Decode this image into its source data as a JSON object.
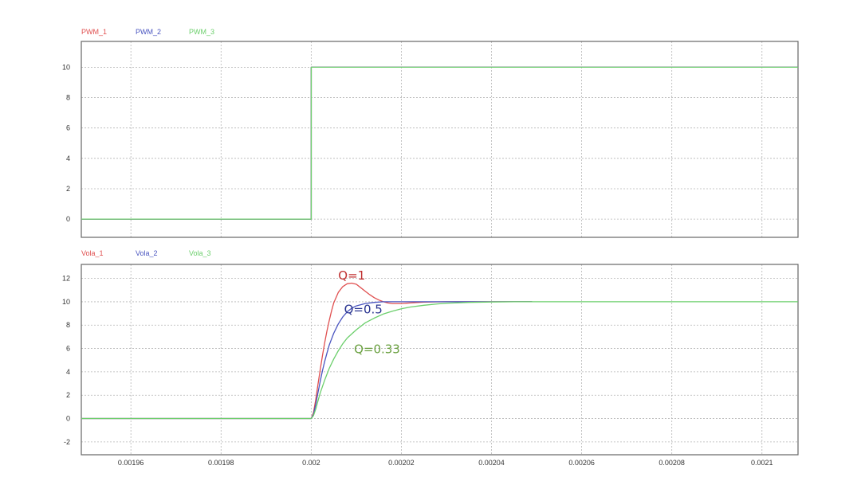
{
  "chart_data": [
    {
      "type": "line",
      "legend_placement": "top-left",
      "grid": true,
      "xlim": [
        0.001949,
        0.002108
      ],
      "ylim": [
        -1.2,
        11.7
      ],
      "x_ticks": [
        0.00196,
        0.00198,
        0.002,
        0.00202,
        0.00204,
        0.00206,
        0.00208,
        0.0021
      ],
      "x_tick_labels": [
        "0.00196",
        "0.00198",
        "0.002",
        "0.00202",
        "0.00204",
        "0.00206",
        "0.00208",
        "0.0021"
      ],
      "y_ticks": [
        0,
        2,
        4,
        6,
        8,
        10
      ],
      "y_tick_labels": [
        "0",
        "2",
        "4",
        "6",
        "8",
        "10"
      ],
      "series": [
        {
          "name": "PWM_1",
          "color": "#e05050",
          "x": [
            0.001949,
            0.002,
            0.002,
            0.002108
          ],
          "y": [
            0,
            0,
            10,
            10
          ]
        },
        {
          "name": "PWM_2",
          "color": "#4a55c0",
          "x": [
            0.001949,
            0.002,
            0.002,
            0.002108
          ],
          "y": [
            0,
            0,
            10,
            10
          ]
        },
        {
          "name": "PWM_3",
          "color": "#6ccf6c",
          "x": [
            0.001949,
            0.002,
            0.002,
            0.002108
          ],
          "y": [
            0,
            0,
            10,
            10
          ]
        }
      ]
    },
    {
      "type": "line",
      "legend_placement": "top-left",
      "grid": true,
      "xlim": [
        0.001949,
        0.002108
      ],
      "ylim": [
        -3.1,
        13.2
      ],
      "x_ticks": [
        0.00196,
        0.00198,
        0.002,
        0.00202,
        0.00204,
        0.00206,
        0.00208,
        0.0021
      ],
      "x_tick_labels": [
        "0.00196",
        "0.00198",
        "0.002",
        "0.00202",
        "0.00204",
        "0.00206",
        "0.00208",
        "0.0021"
      ],
      "y_ticks": [
        -2,
        0,
        2,
        4,
        6,
        8,
        10,
        12
      ],
      "y_tick_labels": [
        "-2",
        "0",
        "2",
        "4",
        "6",
        "8",
        "10",
        "12"
      ],
      "annotations": [
        {
          "text": "Q=1",
          "color": "#c03030",
          "x": 0.002006,
          "y": 11.9
        },
        {
          "text": "Q=0.5",
          "color": "#2a3590",
          "x": 0.0020073,
          "y": 9.0
        },
        {
          "text": "Q=0.33",
          "color": "#6aa040",
          "x": 0.0020095,
          "y": 5.6
        }
      ],
      "series": [
        {
          "name": "Vola_1",
          "color": "#e05050",
          "x": [
            0.001949,
            0.002,
            0.0020005,
            0.002001,
            0.0020015,
            0.002002,
            0.0020025,
            0.002003,
            0.0020035,
            0.002004,
            0.0020045,
            0.002005,
            0.002006,
            0.002007,
            0.002008,
            0.002009,
            0.00201,
            0.002011,
            0.002012,
            0.002013,
            0.002014,
            0.002015,
            0.002016,
            0.002017,
            0.002018,
            0.00202,
            0.002022,
            0.002025,
            0.00203,
            0.002035,
            0.00204,
            0.002045,
            0.002049
          ],
          "y": [
            0,
            0,
            0.5,
            1.6,
            2.9,
            4.2,
            5.4,
            6.5,
            7.5,
            8.4,
            9.2,
            9.9,
            10.8,
            11.3,
            11.55,
            11.6,
            11.5,
            11.2,
            10.9,
            10.6,
            10.35,
            10.15,
            10.0,
            9.9,
            9.85,
            9.85,
            9.9,
            9.97,
            10.0,
            10.0,
            10.0,
            10.0,
            10.0
          ]
        },
        {
          "name": "Vola_2",
          "color": "#4a55c0",
          "x": [
            0.001949,
            0.002,
            0.0020005,
            0.002001,
            0.0020015,
            0.002002,
            0.0020025,
            0.002003,
            0.0020035,
            0.002004,
            0.002005,
            0.002006,
            0.002007,
            0.002008,
            0.002009,
            0.00201,
            0.002012,
            0.002014,
            0.002016,
            0.002018,
            0.00202,
            0.002022,
            0.002025,
            0.00203,
            0.002035,
            0.00204,
            0.002049
          ],
          "y": [
            0,
            0,
            0.35,
            1.2,
            2.2,
            3.2,
            4.1,
            4.9,
            5.6,
            6.3,
            7.3,
            8.1,
            8.7,
            9.15,
            9.45,
            9.65,
            9.85,
            9.95,
            10.0,
            10.0,
            10.0,
            10.0,
            10.0,
            10.0,
            10.0,
            10.0,
            10.0
          ]
        },
        {
          "name": "Vola_3",
          "color": "#6ccf6c",
          "x": [
            0.001949,
            0.002,
            0.0020005,
            0.002001,
            0.0020015,
            0.002002,
            0.002003,
            0.002004,
            0.002005,
            0.002006,
            0.002007,
            0.002008,
            0.00201,
            0.002012,
            0.002014,
            0.002016,
            0.002018,
            0.00202,
            0.002022,
            0.002025,
            0.002028,
            0.00203,
            0.002035,
            0.00204,
            0.002045,
            0.002049,
            0.00206,
            0.00208,
            0.002108
          ],
          "y": [
            0,
            0,
            0.25,
            0.8,
            1.5,
            2.2,
            3.3,
            4.3,
            5.1,
            5.8,
            6.4,
            6.9,
            7.6,
            8.2,
            8.6,
            8.95,
            9.2,
            9.4,
            9.55,
            9.7,
            9.82,
            9.88,
            9.95,
            9.98,
            10.0,
            10.0,
            10.0,
            10.0,
            10.0
          ]
        }
      ]
    }
  ]
}
